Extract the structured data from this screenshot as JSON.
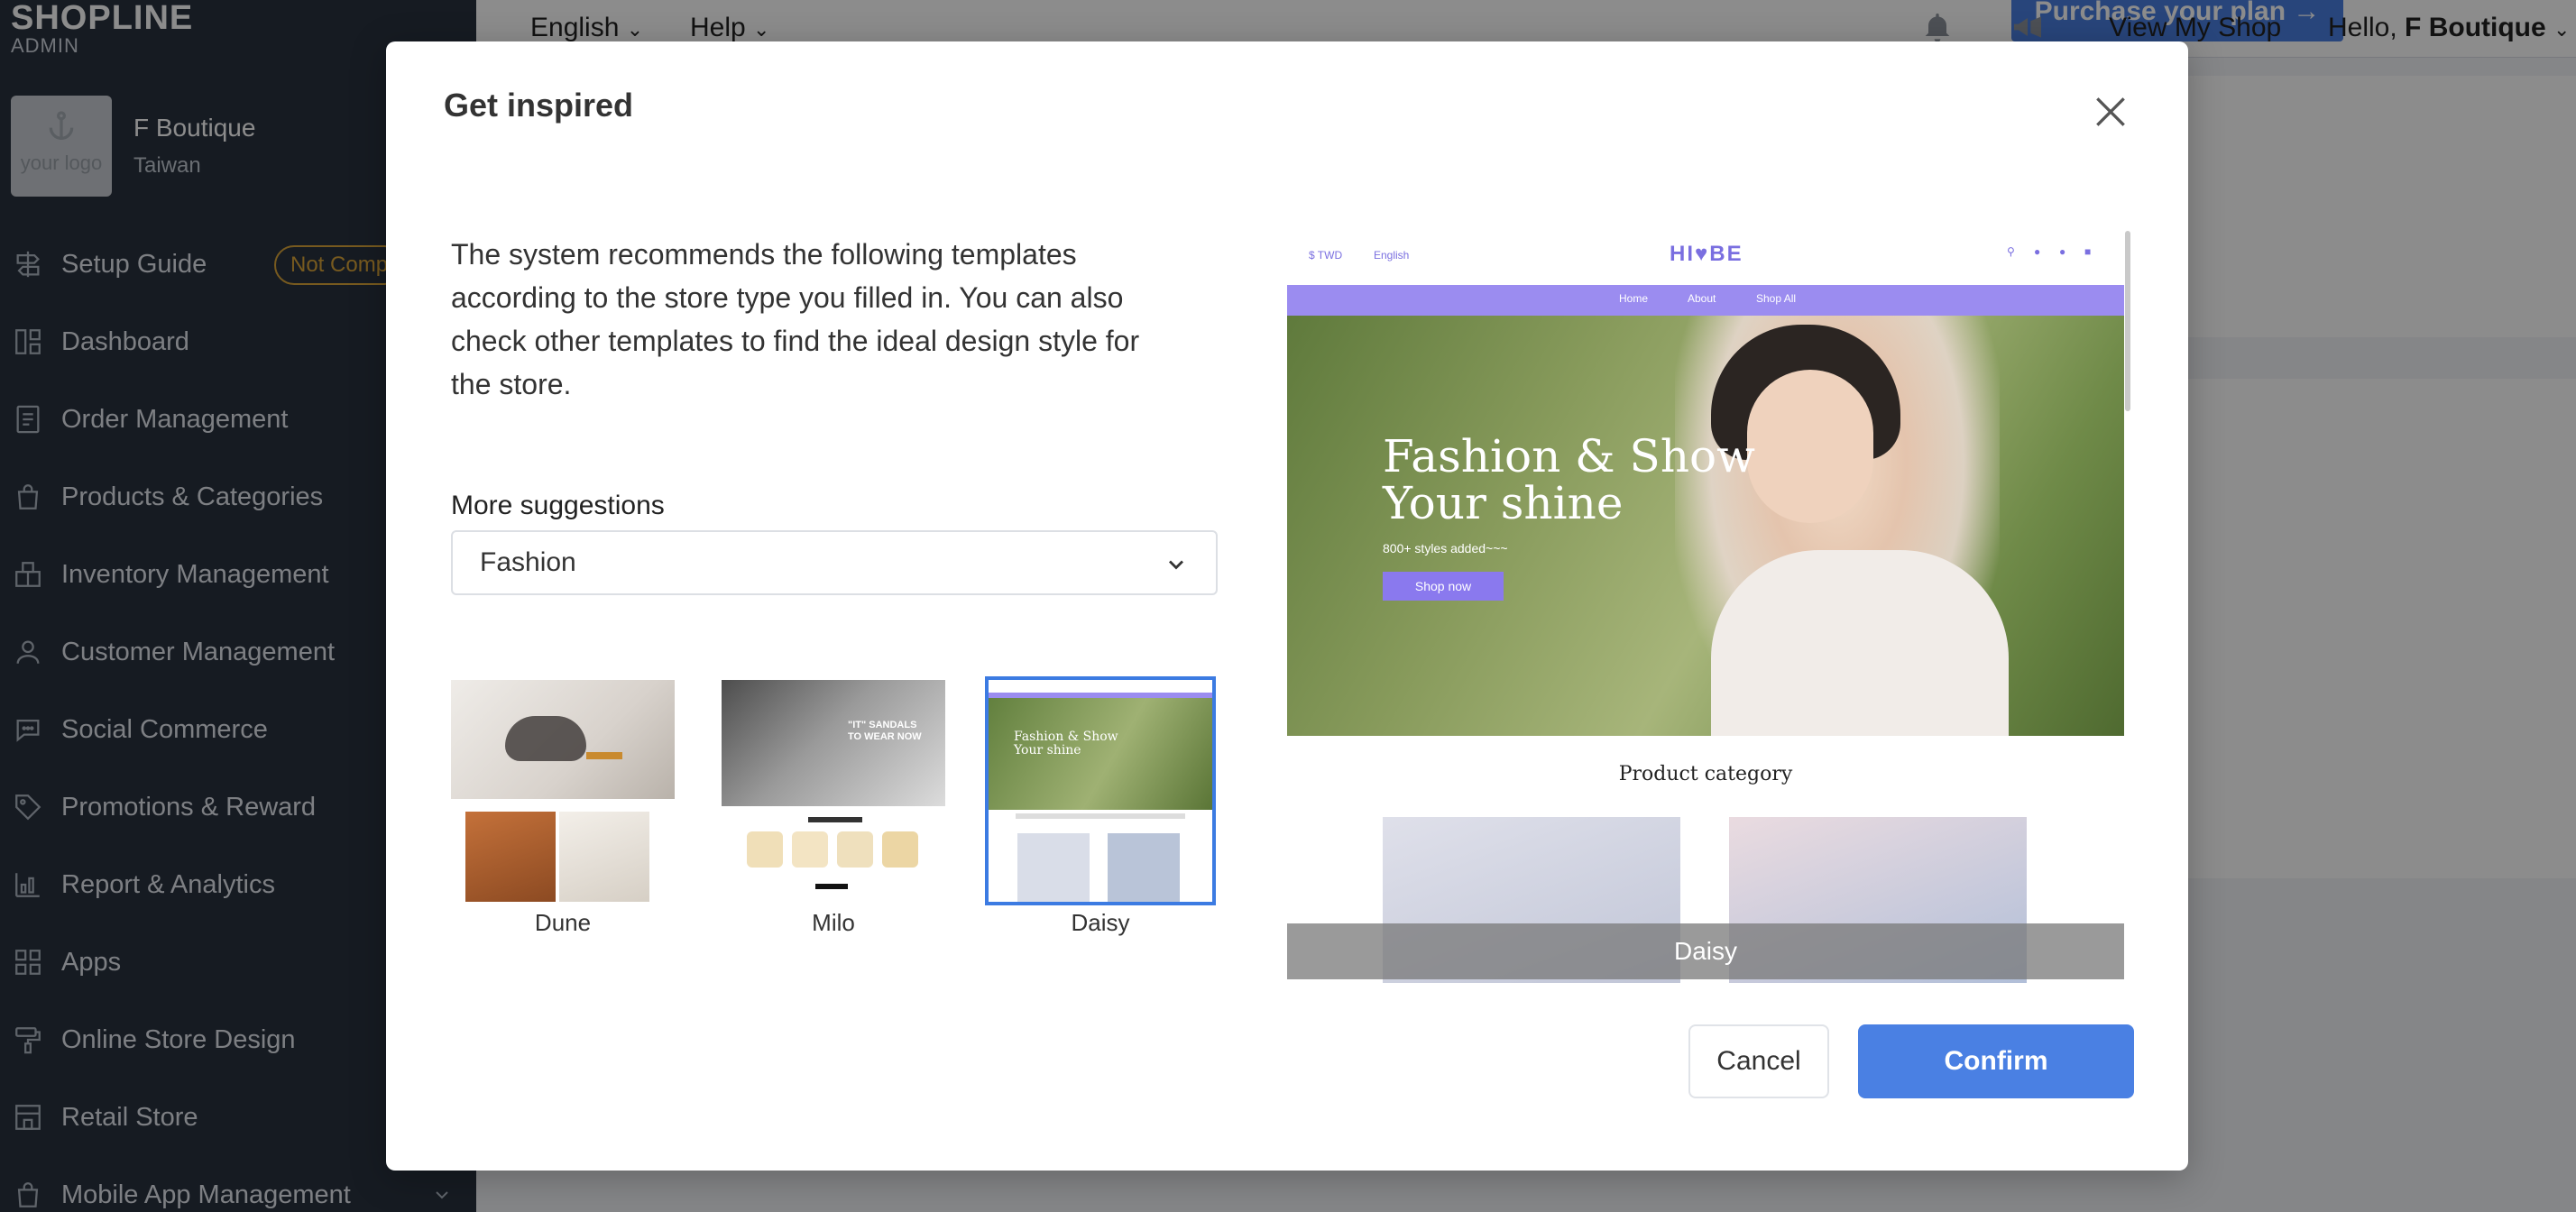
{
  "brand": {
    "name": "SHOPLINE",
    "sub": "ADMIN"
  },
  "shop": {
    "logo_text": "your logo",
    "name": "F Boutique",
    "region": "Taiwan"
  },
  "sidebar": {
    "items": [
      {
        "label": "Setup Guide",
        "icon": "signpost-icon",
        "badge": "Not Comp"
      },
      {
        "label": "Dashboard",
        "icon": "dashboard-icon"
      },
      {
        "label": "Order Management",
        "icon": "document-icon"
      },
      {
        "label": "Products & Categories",
        "icon": "shopping-bag-icon"
      },
      {
        "label": "Inventory Management",
        "icon": "warehouse-icon"
      },
      {
        "label": "Customer Management",
        "icon": "user-icon"
      },
      {
        "label": "Social Commerce",
        "icon": "chat-bubble-icon"
      },
      {
        "label": "Promotions & Reward",
        "icon": "tag-icon"
      },
      {
        "label": "Report & Analytics",
        "icon": "bar-chart-icon"
      },
      {
        "label": "Apps",
        "icon": "apps-grid-icon"
      },
      {
        "label": "Online Store Design",
        "icon": "paint-roller-icon"
      },
      {
        "label": "Retail Store",
        "icon": "store-icon"
      },
      {
        "label": "Mobile App Management",
        "icon": "mobile-bag-icon"
      }
    ]
  },
  "topbar": {
    "language": "English",
    "help": "Help",
    "purchase": "Purchase your plan →",
    "view_shop": "View My Shop",
    "greeting": "Hello,",
    "user": "F Boutique"
  },
  "modal": {
    "title": "Get inspired",
    "description": "The system recommends the following templates according to the store type you filled in. You can also check other templates to find the ideal design style for the store.",
    "more_label": "More suggestions",
    "select_value": "Fashion",
    "templates": [
      {
        "name": "Dune",
        "selected": false
      },
      {
        "name": "Milo",
        "selected": false
      },
      {
        "name": "Daisy",
        "selected": true
      }
    ],
    "preview": {
      "currency": "$ TWD",
      "language": "English",
      "logo": "HI♥BE",
      "menu": [
        "Home",
        "About",
        "Shop All"
      ],
      "hero_title_1": "Fashion & Show",
      "hero_title_2": "Your shine",
      "hero_sub": "800+ styles added~~~",
      "hero_button": "Shop now",
      "category_title": "Product category",
      "caption": "Daisy"
    },
    "cancel": "Cancel",
    "confirm": "Confirm"
  },
  "colors": {
    "accent": "#4a80e3",
    "sidebar": "#29323f",
    "preview_accent": "#9b8cf0",
    "badge": "#d9a43a"
  }
}
